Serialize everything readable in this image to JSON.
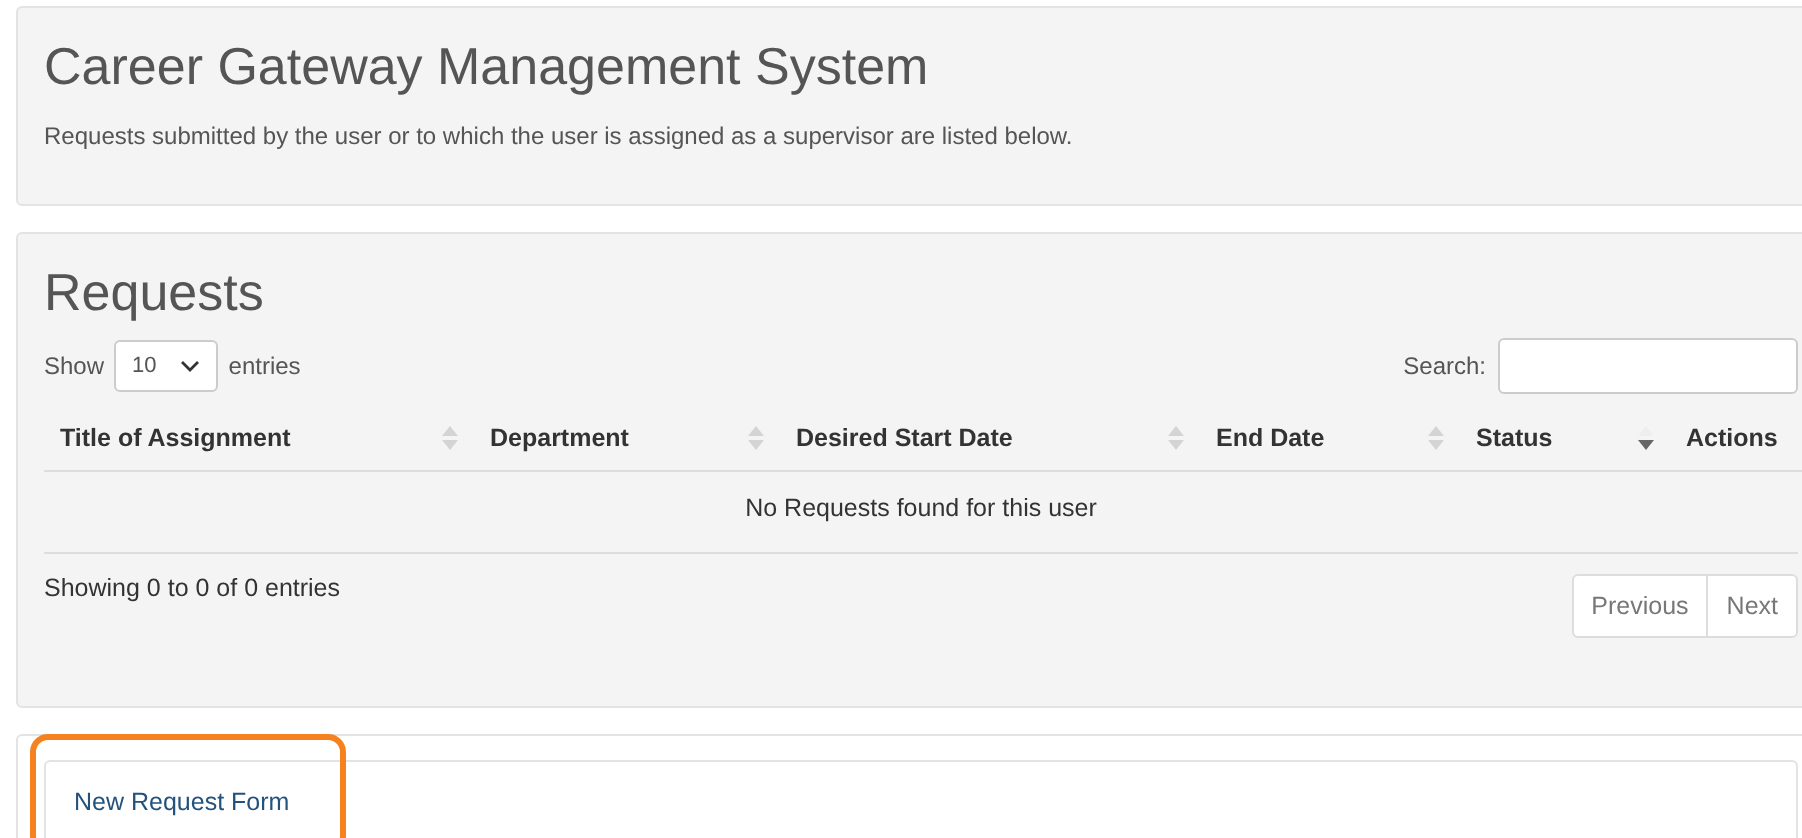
{
  "header": {
    "title": "Career Gateway Management System",
    "description": "Requests submitted by the user or to which the user is assigned as a supervisor are listed below."
  },
  "requests": {
    "title": "Requests",
    "length": {
      "before": "Show",
      "value": "10",
      "after": "entries"
    },
    "search": {
      "label": "Search:"
    },
    "table": {
      "columns": [
        {
          "label": "Title of Assignment",
          "sortable": true,
          "sorted": false
        },
        {
          "label": "Department",
          "sortable": true,
          "sorted": false
        },
        {
          "label": "Desired Start Date",
          "sortable": true,
          "sorted": false
        },
        {
          "label": "End Date",
          "sortable": true,
          "sorted": false
        },
        {
          "label": "Status",
          "sortable": true,
          "sorted": true
        },
        {
          "label": "Actions",
          "sortable": false
        }
      ],
      "empty_message": "No Requests found for this user"
    },
    "info": "Showing 0 to 0 of 0 entries",
    "pagination": [
      {
        "label": "Previous",
        "disabled": true
      },
      {
        "label": "Next",
        "disabled": true
      }
    ]
  },
  "new_request": {
    "label": "New Request Form",
    "highlighted": true
  }
}
